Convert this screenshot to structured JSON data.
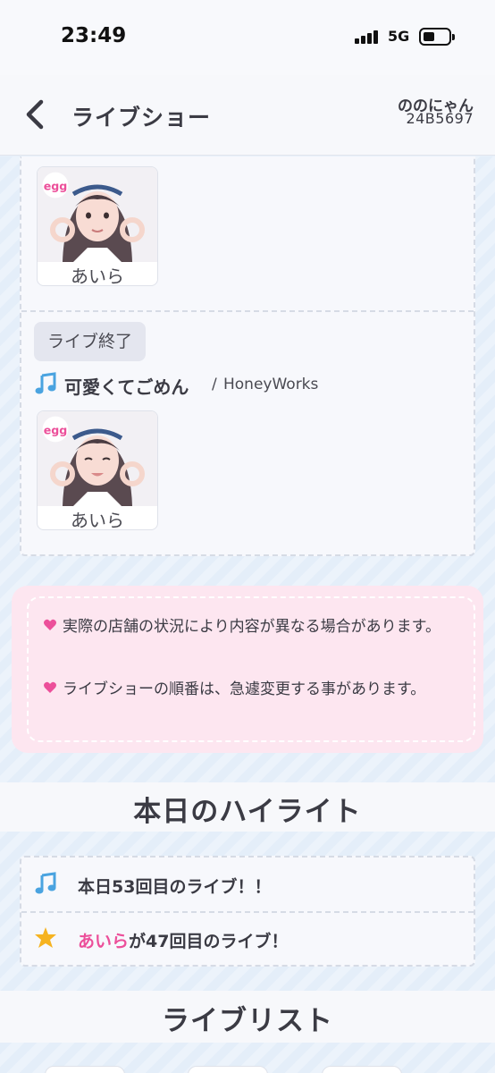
{
  "status_bar": {
    "time": "23:49",
    "network": "5G"
  },
  "header": {
    "title": "ライブショー",
    "user_name": "ののにゃん",
    "user_id": "24B5697"
  },
  "live": {
    "top_performer": "あいら",
    "entry": {
      "status": "ライブ終了",
      "song_title": "可愛くてごめん",
      "separator": "/",
      "artist": "HoneyWorks",
      "performer": "あいら"
    },
    "logo_text": "egg"
  },
  "notice": {
    "line1": "実際の店舗の状況により内容が異なる場合があります。",
    "line2": "ライブショーの順番は、急遽変更する事があります。"
  },
  "highlights": {
    "title": "本日のハイライト",
    "item1": "本日53回目のライブ！！",
    "item2_name": "あいら",
    "item2_rest": "が47回目のライブ！"
  },
  "live_list": {
    "title": "ライブリスト"
  },
  "colors": {
    "accent_pink": "#ec4f9a",
    "music_blue": "#4aa3e0",
    "star_yellow": "#f6b320"
  }
}
